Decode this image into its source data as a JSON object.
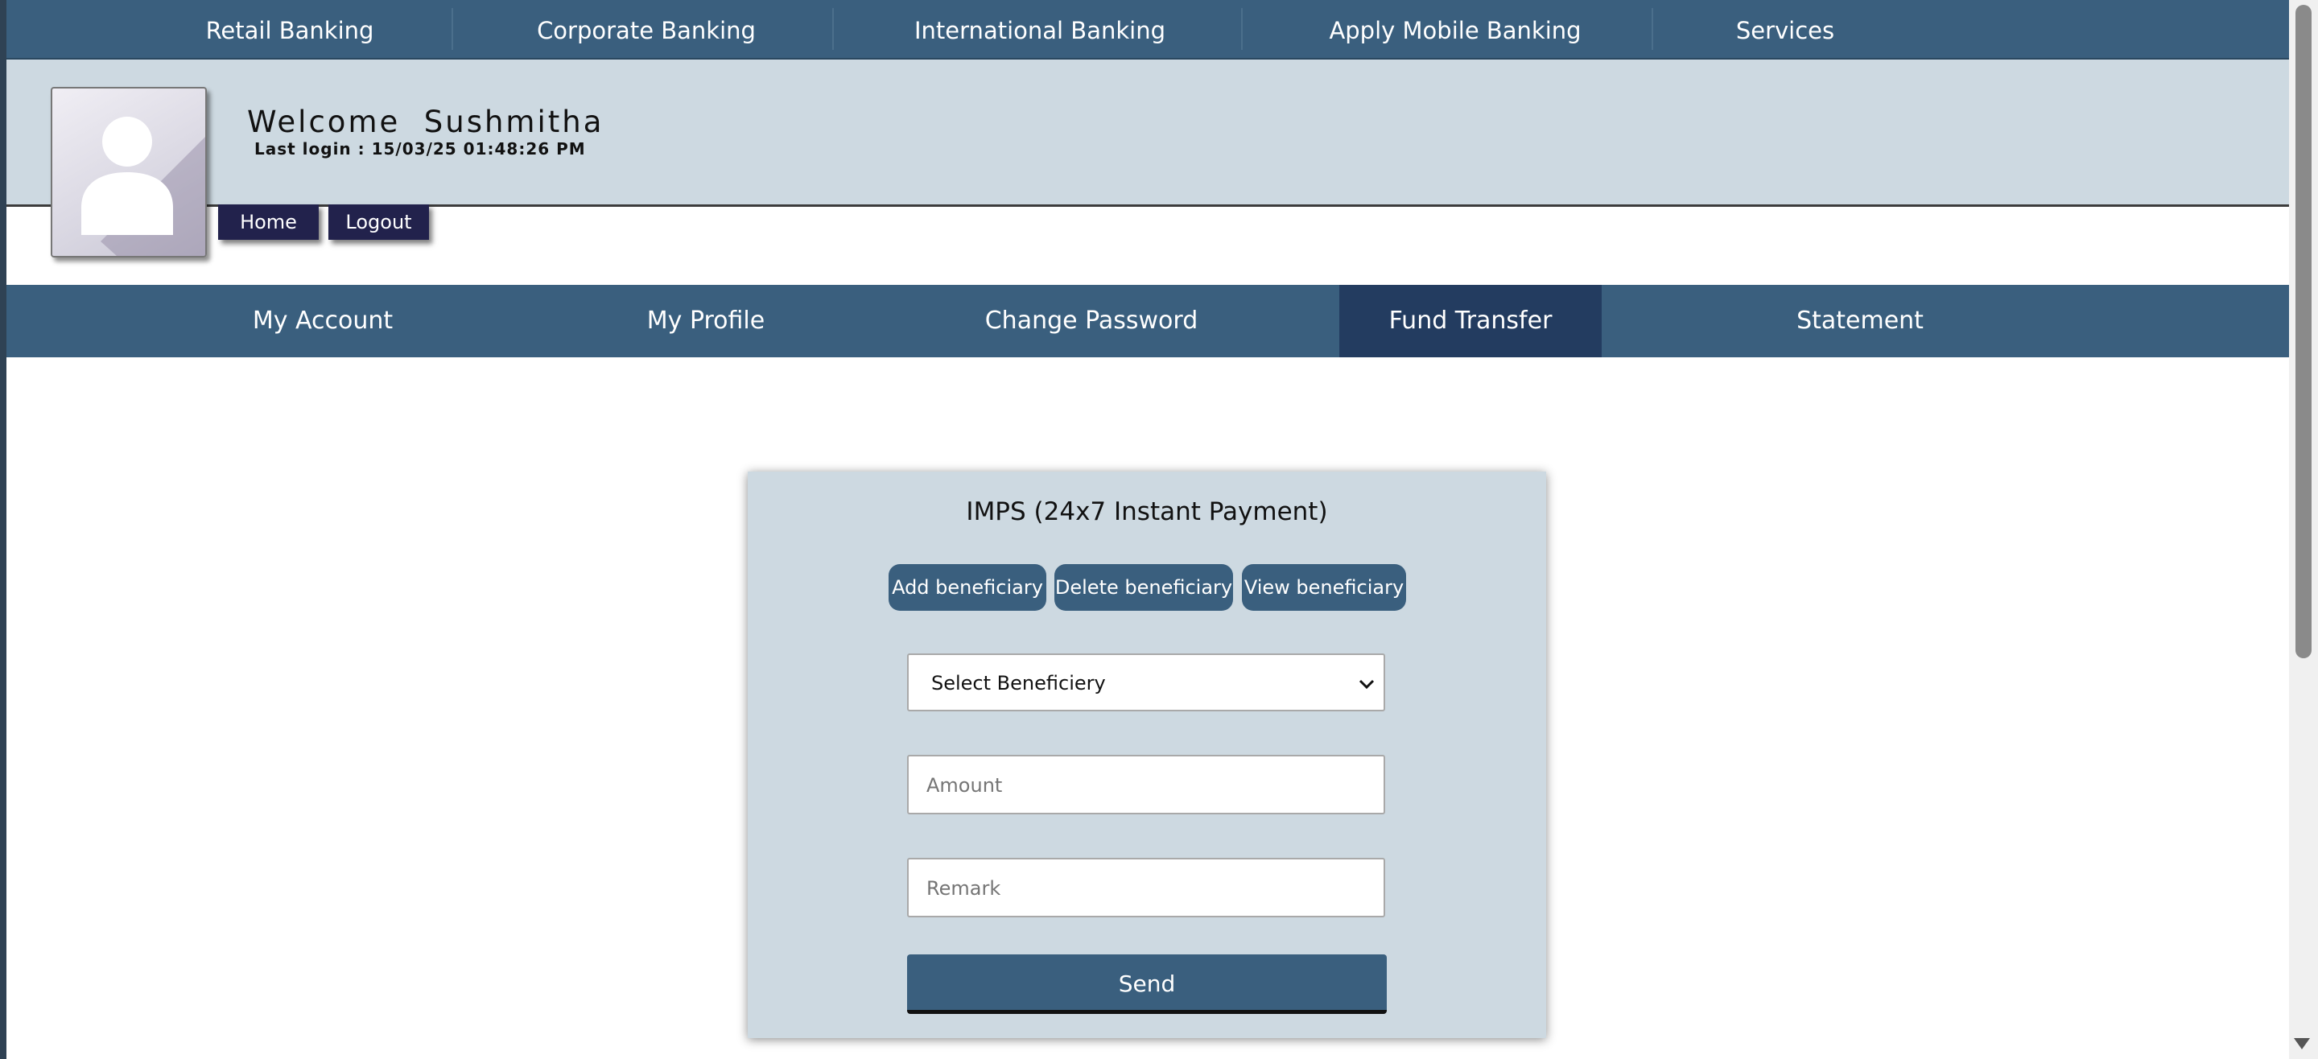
{
  "top_nav": {
    "items": [
      "Retail Banking",
      "Corporate Banking",
      "International Banking",
      "Apply Mobile Banking",
      "Services"
    ]
  },
  "header": {
    "welcome": "Welcome  Sushmitha",
    "last_login": "Last login : 15/03/25 01:48:26 PM",
    "home_label": "Home",
    "logout_label": "Logout",
    "avatar_icon": "user-silhouette-icon"
  },
  "secondary_nav": {
    "items": [
      "My Account",
      "My Profile",
      "Change Password",
      "Fund Transfer",
      "Statement"
    ],
    "active": "Fund Transfer"
  },
  "imps_form": {
    "title": "IMPS (24x7 Instant Payment)",
    "add_label": "Add beneficiary",
    "delete_label": "Delete beneficiary",
    "view_label": "View beneficiary",
    "beneficiary_select": "Select Beneficiery",
    "amount_placeholder": "Amount",
    "remark_placeholder": "Remark",
    "send_label": "Send"
  },
  "colors": {
    "nav": "#3a5f7e",
    "active_nav": "#233c60",
    "header_bg": "#cdd9e1",
    "header_buttons": "#22224c"
  }
}
